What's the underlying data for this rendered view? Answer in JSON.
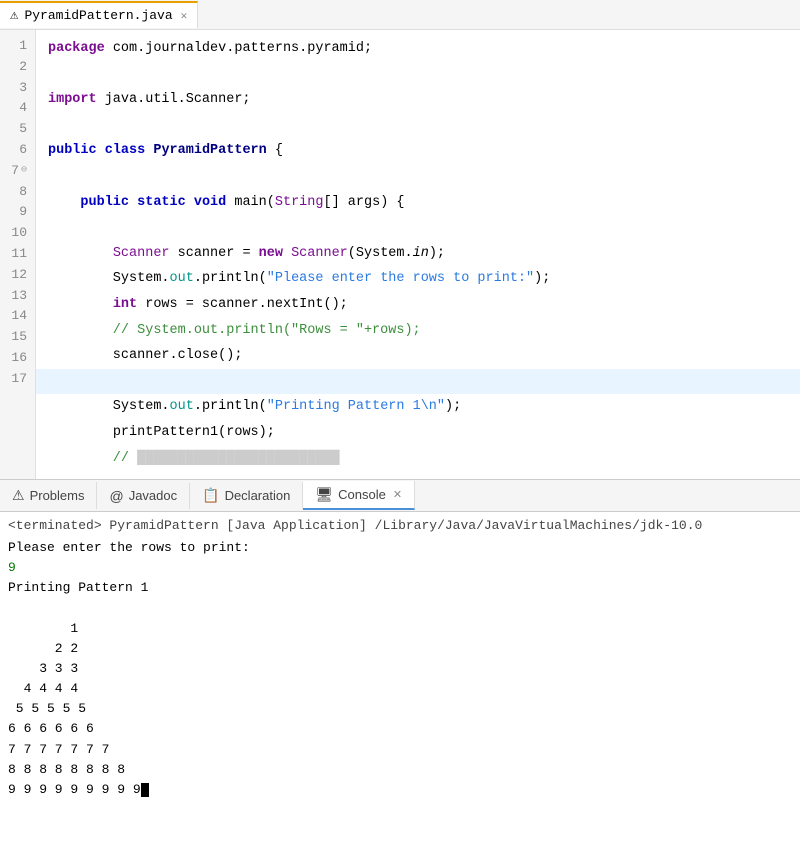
{
  "editor_tab": {
    "filename": "PyramidPattern.java",
    "close_icon": "✕",
    "warning_icon": "⚠"
  },
  "code_lines": [
    {
      "num": 1,
      "content": "package com.journaldev.patterns.pyramid;",
      "type": "normal"
    },
    {
      "num": 2,
      "content": "",
      "type": "normal"
    },
    {
      "num": 3,
      "content": "import java.util.Scanner;",
      "type": "normal"
    },
    {
      "num": 4,
      "content": "",
      "type": "normal"
    },
    {
      "num": 5,
      "content": "public class PyramidPattern {",
      "type": "normal"
    },
    {
      "num": 6,
      "content": "",
      "type": "normal"
    },
    {
      "num": 7,
      "content": "    public static void main(String[] args) {",
      "type": "collapse"
    },
    {
      "num": 8,
      "content": "",
      "type": "normal"
    },
    {
      "num": 9,
      "content": "        Scanner scanner = new Scanner(System.in);",
      "type": "normal"
    },
    {
      "num": 10,
      "content": "        System.out.println(\"Please enter the rows to print:\");",
      "type": "normal"
    },
    {
      "num": 11,
      "content": "        int rows = scanner.nextInt();",
      "type": "normal"
    },
    {
      "num": 12,
      "content": "        // System.out.println(\"Rows = \"+rows);",
      "type": "comment"
    },
    {
      "num": 13,
      "content": "        scanner.close();",
      "type": "normal"
    },
    {
      "num": 14,
      "content": "",
      "type": "highlighted"
    },
    {
      "num": 15,
      "content": "        System.out.println(\"Printing Pattern 1\\n\");",
      "type": "normal"
    },
    {
      "num": 16,
      "content": "        printPattern1(rows);",
      "type": "normal"
    },
    {
      "num": 17,
      "content": "",
      "type": "partial"
    }
  ],
  "panel_tabs": [
    {
      "id": "problems",
      "label": "Problems",
      "icon": "⚠",
      "active": false
    },
    {
      "id": "javadoc",
      "label": "Javadoc",
      "icon": "@",
      "active": false
    },
    {
      "id": "declaration",
      "label": "Declaration",
      "icon": "📋",
      "active": false
    },
    {
      "id": "console",
      "label": "Console",
      "icon": "🖥",
      "active": true,
      "close_icon": "✕"
    }
  ],
  "console": {
    "terminated_line": "<terminated> PyramidPattern [Java Application] /Library/Java/JavaVirtualMachines/jdk-10.0",
    "output_lines": [
      "Please enter the rows to print:",
      "9",
      "Printing Pattern 1",
      "",
      "        1",
      "      2 2",
      "    3 3 3",
      "  4 4 4 4",
      " 5 5 5 5 5",
      "6 6 6 6 6 6",
      "7 7 7 7 7 7 7",
      "8 8 8 8 8 8 8 8",
      "9 9 9 9 9 9 9 9 9"
    ]
  }
}
